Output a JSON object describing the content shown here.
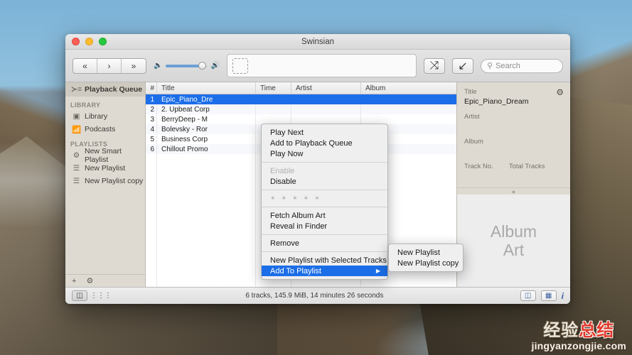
{
  "window": {
    "title": "Swinsian",
    "traffic_lights": [
      "close",
      "minimize",
      "maximize"
    ]
  },
  "toolbar": {
    "prev_label": "«",
    "play_label": "›",
    "next_label": "»",
    "volume_low_icon": "speaker-low-icon",
    "volume_high_icon": "speaker-high-icon",
    "volume_percent": 85,
    "now_playing_placeholder": "",
    "shuffle_label": "⤨",
    "repeat_label": "↙",
    "search": {
      "placeholder": "Search",
      "value": "",
      "icon": "search-icon"
    }
  },
  "sidebar": {
    "queue": {
      "label": "Playback Queue",
      "icon": "playback-queue-icon"
    },
    "sections": [
      {
        "heading": "LIBRARY",
        "items": [
          {
            "label": "Library",
            "icon": "library-icon"
          },
          {
            "label": "Podcasts",
            "icon": "podcast-icon"
          }
        ]
      },
      {
        "heading": "PLAYLISTS",
        "items": [
          {
            "label": "New Smart Playlist",
            "icon": "smart-playlist-icon"
          },
          {
            "label": "New Playlist",
            "icon": "playlist-icon"
          },
          {
            "label": "New Playlist copy",
            "icon": "playlist-icon"
          }
        ]
      }
    ],
    "footer": {
      "add_label": "+",
      "gear_label": "⚙"
    }
  },
  "tracklist": {
    "columns": [
      "#",
      "Title",
      "Time",
      "Artist",
      "Album"
    ],
    "rows": [
      {
        "num": "1",
        "title": "Epic_Piano_Dre",
        "time": "",
        "artist": "",
        "album": "",
        "selected": true
      },
      {
        "num": "2",
        "title": "2. Upbeat Corp",
        "time": "",
        "artist": "",
        "album": "",
        "selected": false
      },
      {
        "num": "3",
        "title": "BerryDeep - M",
        "time": "",
        "artist": "",
        "album": "",
        "selected": false
      },
      {
        "num": "4",
        "title": "Bolevsky - Ror",
        "time": "",
        "artist": "",
        "album": "",
        "selected": false
      },
      {
        "num": "5",
        "title": "Business Corp",
        "time": "",
        "artist": "",
        "album": "",
        "selected": false
      },
      {
        "num": "6",
        "title": "Chillout Promo",
        "time": "",
        "artist": "",
        "album": "",
        "selected": false
      }
    ]
  },
  "inspector": {
    "gear_icon": "gear-icon",
    "fields": [
      {
        "label": "Title",
        "value": "Epic_Piano_Dream"
      },
      {
        "label": "Artist",
        "value": ""
      },
      {
        "label": "Album",
        "value": ""
      }
    ],
    "track_no_label": "Track No.",
    "track_no_value": "",
    "total_tracks_label": "Total Tracks",
    "total_tracks_value": "",
    "album_art_line1": "Album",
    "album_art_line2": "Art"
  },
  "statusbar": {
    "sidebar_toggle_icon": "sidebar-toggle-icon",
    "equalizer_icon": "equalizer-icon",
    "summary": "6 tracks,  145.9 MiB,  14 minutes 26 seconds",
    "split_view_icon": "split-view-icon",
    "list_view_icon": "list-view-icon",
    "info_icon": "info-icon"
  },
  "context_menu": {
    "items": [
      {
        "label": "Play Next",
        "state": "normal"
      },
      {
        "label": "Add to Playback Queue",
        "state": "normal"
      },
      {
        "label": "Play Now",
        "state": "normal"
      },
      {
        "type": "separator"
      },
      {
        "label": "Enable",
        "state": "disabled"
      },
      {
        "label": "Disable",
        "state": "normal"
      },
      {
        "type": "separator"
      },
      {
        "type": "stars",
        "count": 5
      },
      {
        "type": "separator"
      },
      {
        "label": "Fetch Album Art",
        "state": "normal"
      },
      {
        "label": "Reveal in Finder",
        "state": "normal"
      },
      {
        "type": "separator"
      },
      {
        "label": "Remove",
        "state": "normal"
      },
      {
        "type": "separator"
      },
      {
        "label": "New Playlist with Selected Tracks",
        "state": "normal"
      },
      {
        "label": "Add To Playlist",
        "state": "highlighted",
        "submenu_arrow": "▶"
      }
    ]
  },
  "submenu": {
    "items": [
      {
        "label": "New Playlist"
      },
      {
        "label": "New Playlist copy"
      }
    ]
  },
  "watermark": {
    "cn_part1": "经验",
    "cn_part2": "总结",
    "url": "jingyanzongjie.com"
  },
  "colors": {
    "selection_blue": "#1c6ee8",
    "sidebar_bg": "#dedad2",
    "accent_volume": "#6d9fd6"
  }
}
